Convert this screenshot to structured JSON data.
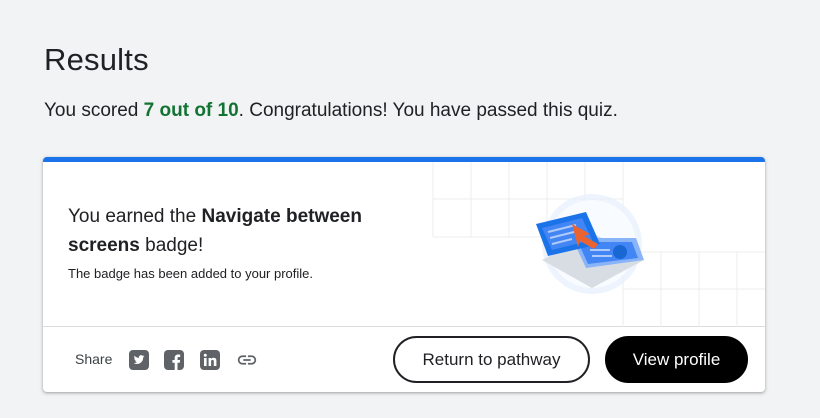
{
  "results": {
    "title": "Results",
    "score_prefix": "You scored ",
    "score": "7 out of 10",
    "score_suffix": ". Congratulations! You have passed this quiz."
  },
  "badge_card": {
    "earned_prefix": "You earned the ",
    "badge_name": "Navigate between screens",
    "earned_suffix": " badge!",
    "added_text": "The badge has been added to your profile.",
    "accent_color": "#1a73e8",
    "badge_icon": "navigate-between-screens-badge"
  },
  "footer": {
    "share_label": "Share",
    "social_icons": [
      "twitter-icon",
      "facebook-icon",
      "linkedin-icon",
      "link-icon"
    ],
    "return_button": "Return to pathway",
    "view_profile_button": "View profile"
  }
}
